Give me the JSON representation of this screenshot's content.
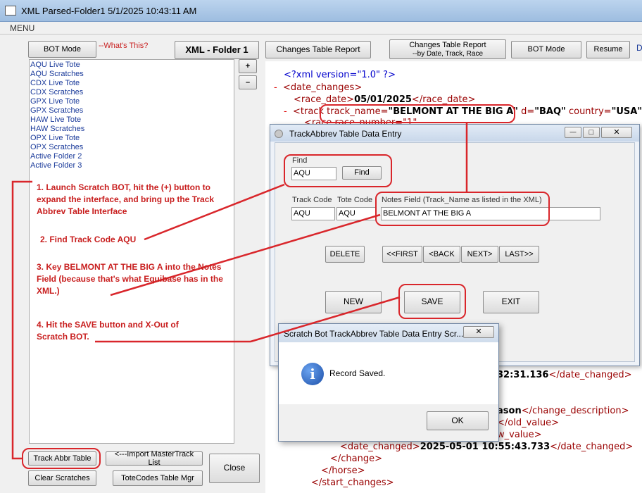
{
  "window": {
    "title": "XML Parsed-Folder1 5/1/2025 10:43:11 AM",
    "menu": "MENU"
  },
  "left_panel": {
    "bot_mode": "BOT Mode",
    "whats_this": "--What's This?",
    "folder_title": "XML - Folder 1",
    "plus": "+",
    "minus": "–",
    "list": [
      "AQU Live Tote",
      "AQU Scratches",
      "CDX Live Tote",
      "CDX Scratches",
      "GPX Live Tote",
      "GPX Scratches",
      "HAW Live Tote",
      "HAW Scratches",
      "OPX Live Tote",
      "OPX Scratches",
      "Active Folder 2",
      "Active Folder 3"
    ],
    "track_abbr": "Track Abbr Table",
    "import_master": "<---Import MasterTrack List",
    "clear_scratches": "Clear Scratches",
    "totecodes": "ToteCodes Table Mgr",
    "close": "Close"
  },
  "toolbar": {
    "changes_report": "Changes Table Report",
    "changes_report_line1": "Changes Table Report",
    "changes_report_line2": "--by Date, Track, Race",
    "bot_mode": "BOT Mode",
    "resume": "Resume",
    "edge": "D"
  },
  "xml": {
    "decl": "<?xml version=\"1.0\" ?>",
    "l1_tag": "<date_changes>",
    "l2_open": "<race_date>",
    "l2_val": "05/01/2025",
    "l2_close": "</race_date>",
    "l3_open": "<track",
    "l3_attr1": "track_name=",
    "l3_val1": "\"BELMONT AT THE BIG A\"",
    "l3_attr2": "d=",
    "l3_val2": "\"BAQ\"",
    "l3_attr3": "country=",
    "l3_val3": "\"USA\">",
    "l4_partial": "<race race_number=\"1\"",
    "b1_val": "32:31.136",
    "b1_close": "</date_changed>",
    "b2_val": "ason",
    "b2_close": "</change_description>",
    "b3_close": "</old_value>",
    "b4_close": "w_value>",
    "b5_open": "<date_changed>",
    "b5_val": "2025-05-01 10:55:43.733",
    "b5_close": "</date_changed>",
    "b6": "</change>",
    "b7": "</horse>",
    "b8": "</start_changes>",
    "minus_sign": "-"
  },
  "dialog": {
    "title": "TrackAbbrev Table Data Entry",
    "find_label": "Find",
    "find_value": "AQU",
    "find_button": "Find",
    "track_code_label": "Track Code",
    "tote_code_label": "Tote Code",
    "notes_label": "Notes Field (Track_Name as listed in the XML)",
    "track_code_value": "AQU",
    "tote_code_value": "AQU",
    "notes_value": "BELMONT AT THE BIG A",
    "delete": "DELETE",
    "first": "<<FIRST",
    "back": "<BACK",
    "next": "NEXT>",
    "last": "LAST>>",
    "new": "NEW",
    "save": "SAVE",
    "exit": "EXIT",
    "ctrl_min": "—",
    "ctrl_max": "□",
    "ctrl_close": "✕"
  },
  "msgbox": {
    "title": "Scratch Bot TrackAbbrev Table Data Entry Scr...",
    "message": "Record Saved.",
    "ok": "OK",
    "info_glyph": "i",
    "close": "✕"
  },
  "instructions": {
    "step1": "1. Launch Scratch BOT, hit the (+) button to expand the interface, and  bring up the Track Abbrev Table Interface",
    "step2": "2. Find Track Code AQU",
    "step3": "3. Key BELMONT AT THE BIG A into the Notes Field (because that's what Equibase has in the XML.)",
    "step4": "4. Hit the SAVE button and X-Out of Scratch BOT."
  },
  "colors": {
    "annotation": "#d9262b",
    "xml_tag": "#990000",
    "list_text": "#1a3a9a"
  }
}
